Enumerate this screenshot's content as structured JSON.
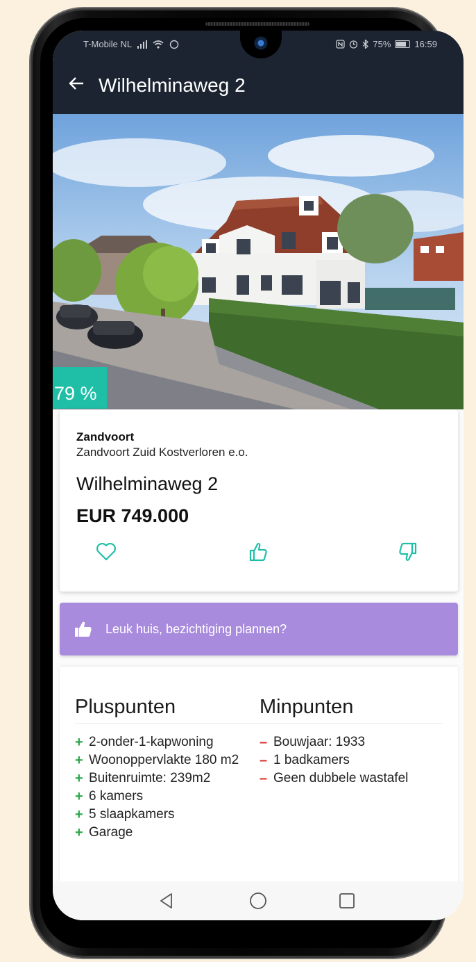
{
  "status_bar": {
    "carrier": "T-Mobile NL",
    "battery": "75%",
    "time": "16:59"
  },
  "app_bar": {
    "back_icon": "arrow-left-icon",
    "title": "Wilhelminaweg 2"
  },
  "listing": {
    "match": "79 %",
    "city": "Zandvoort",
    "district": "Zandvoort Zuid Kostverloren e.o.",
    "street": "Wilhelminaweg 2",
    "price": "EUR 749.000",
    "actions": [
      "heart-icon",
      "thumbs-up-icon",
      "thumbs-down-icon"
    ]
  },
  "banner": {
    "icon": "thumbs-up-filled-icon",
    "text": "Leuk huis, bezichtiging plannen?"
  },
  "pros": {
    "title": "Pluspunten",
    "items": [
      "2-onder-1-kapwoning",
      "Woonoppervlakte 180 m2",
      "Buitenruimte: 239m2",
      "6 kamers",
      "5 slaapkamers",
      "Garage"
    ]
  },
  "cons": {
    "title": "Minpunten",
    "items": [
      "Bouwjaar: 1933",
      "1 badkamers",
      "Geen dubbele wastafel"
    ]
  },
  "nav": [
    "back-triangle-icon",
    "home-circle-icon",
    "recents-square-icon"
  ],
  "colors": {
    "app_bar": "#1c2431",
    "match_badge": "#1fbfa7",
    "action_icons": "#1fbfa7",
    "banner": "#a98bde",
    "plus": "#2aa84a",
    "minus": "#d9302e"
  }
}
